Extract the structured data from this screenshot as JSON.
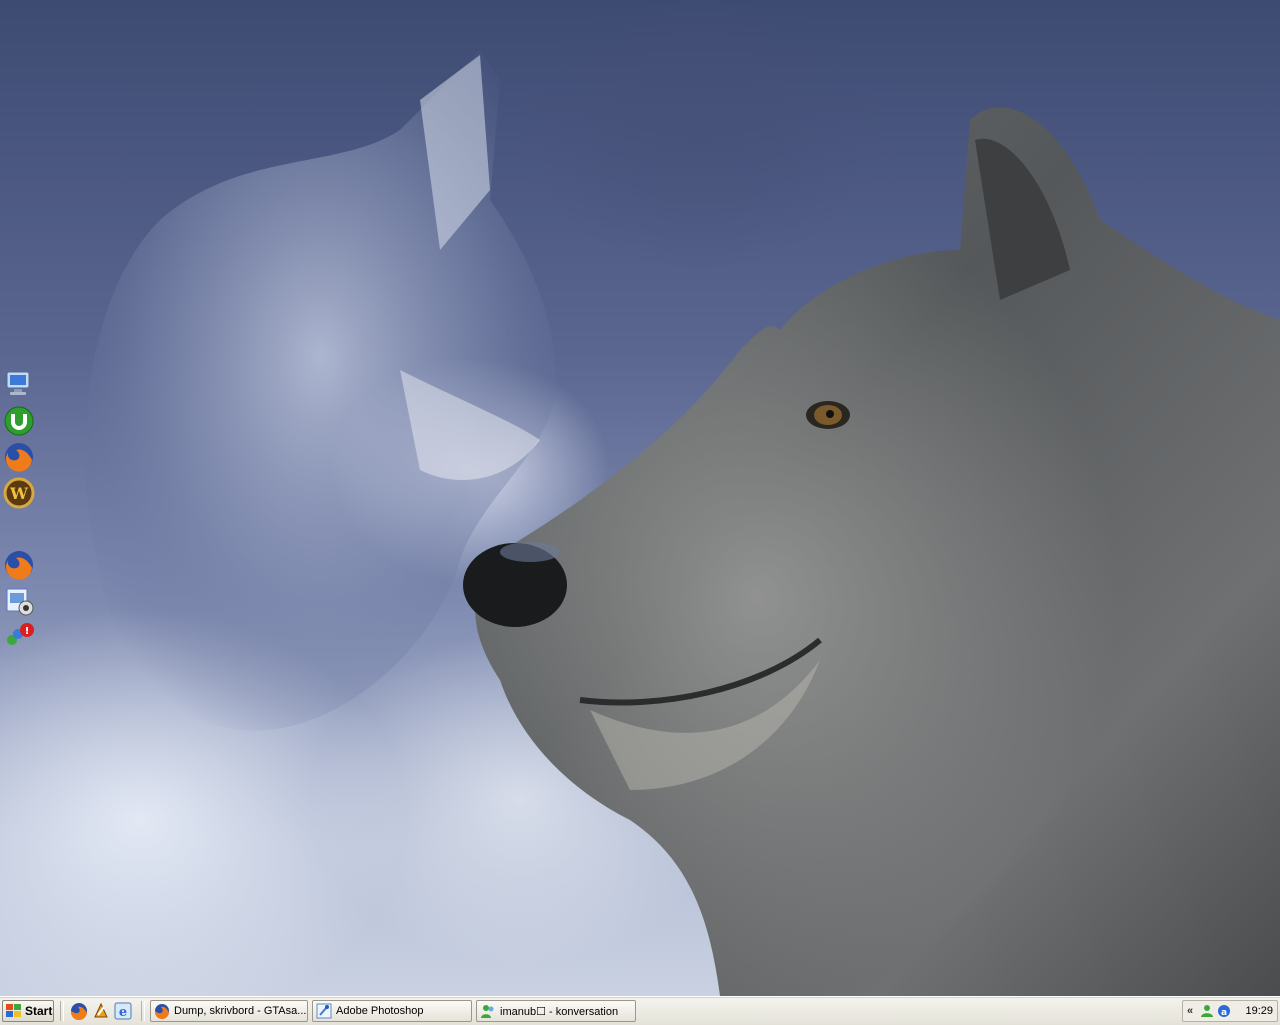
{
  "desktop": {
    "icons": [
      {
        "name": "my-computer-icon",
        "label": ""
      },
      {
        "name": "utorrent-icon",
        "label": ""
      },
      {
        "name": "firefox-icon",
        "label": ""
      },
      {
        "name": "world-of-warcraft-icon",
        "label": ""
      },
      {
        "name": "firefox-icon-2",
        "label": ""
      },
      {
        "name": "image-viewer-icon",
        "label": ""
      },
      {
        "name": "msn-messenger-icon",
        "label": ""
      }
    ]
  },
  "taskbar": {
    "start_label": "Start",
    "quick_launch": [
      "firefox-icon",
      "winamp-icon",
      "internet-explorer-icon"
    ],
    "tasks": [
      {
        "label": "Dump, skrivbord - GTAsa...",
        "icon": "firefox-icon"
      },
      {
        "label": "Adobe Photoshop",
        "icon": "photoshop-icon"
      },
      {
        "label": "imanub☐ - konversation",
        "icon": "msn-messenger-icon"
      }
    ],
    "tray": {
      "chevron": "«",
      "icons": [
        "msn-status-icon",
        "security-icon"
      ],
      "clock": "19:29"
    }
  },
  "colors": {
    "taskbar": "#ece9d8",
    "sky_dark": "#3d4a72",
    "sky_light": "#c9d1e2"
  }
}
